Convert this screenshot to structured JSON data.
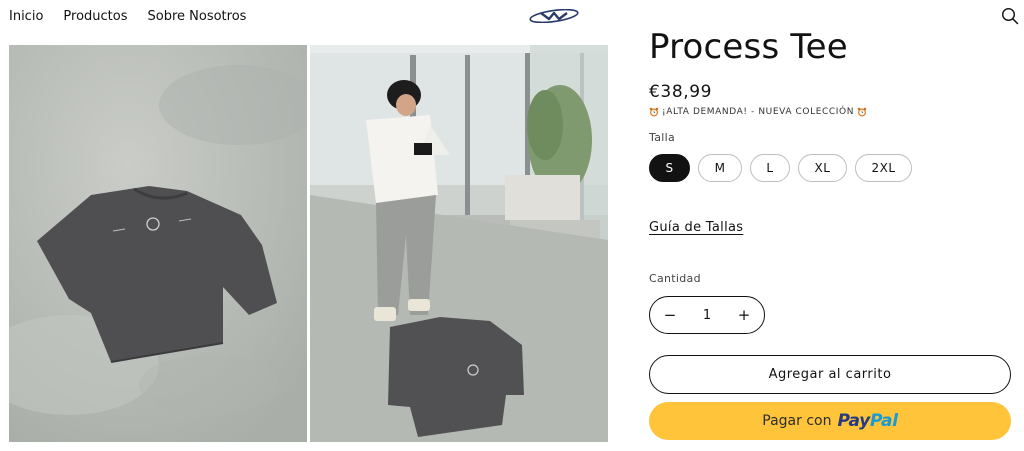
{
  "nav": {
    "items": [
      "Inicio",
      "Productos",
      "Sobre Nosotros"
    ]
  },
  "icons": {
    "logo": "brand-logo-icon",
    "search": "search-icon",
    "alarm": "alarm-clock-icon",
    "minus": "minus-icon",
    "plus": "plus-icon"
  },
  "product": {
    "title": "Process Tee",
    "price": "€38,99",
    "promo": "¡ALTA DEMANDA! - NUEVA COLECCIÓN",
    "size_label": "Talla",
    "sizes": [
      "S",
      "M",
      "L",
      "XL",
      "2XL"
    ],
    "selected_size": "S",
    "size_guide": "Guía de Tallas",
    "quantity_label": "Cantidad",
    "quantity": "1",
    "minus": "−",
    "plus": "+",
    "add_to_cart": "Agregar al carrito",
    "paypal_prefix": "Pagar con",
    "paypal_brand_a": "Pay",
    "paypal_brand_b": "Pal"
  },
  "colors": {
    "text": "#121212",
    "paypal_yellow": "#ffc439",
    "paypal_dark_blue": "#253b80",
    "paypal_light_blue": "#179bd7",
    "shirt": "#4f4f51",
    "concrete": "#b9bdb8"
  }
}
